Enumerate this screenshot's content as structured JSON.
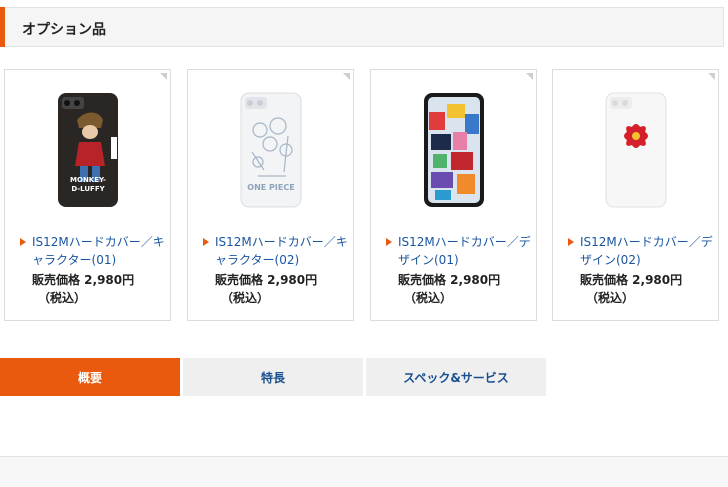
{
  "section": {
    "title": "オプション品"
  },
  "products": [
    {
      "name": "IS12Mハードカバー／キャラクター(01)",
      "price": "販売価格 2,980円",
      "tax": "（税込）",
      "image": "phone-case-character-01"
    },
    {
      "name": "IS12Mハードカバー／キャラクター(02)",
      "price": "販売価格 2,980円",
      "tax": "（税込）",
      "image": "phone-case-character-02"
    },
    {
      "name": "IS12Mハードカバー／デザイン(01)",
      "price": "販売価格 2,980円",
      "tax": "（税込）",
      "image": "phone-case-design-01"
    },
    {
      "name": "IS12Mハードカバー／デザイン(02)",
      "price": "販売価格 2,980円",
      "tax": "（税込）",
      "image": "phone-case-design-02"
    }
  ],
  "tabs": [
    {
      "label": "概要",
      "active": true
    },
    {
      "label": "特長",
      "active": false
    },
    {
      "label": "スペック&サービス",
      "active": false
    }
  ],
  "colors": {
    "accent": "#e95a0e",
    "link": "#1a56a0",
    "tab_inactive_text": "#1a4f8f"
  }
}
